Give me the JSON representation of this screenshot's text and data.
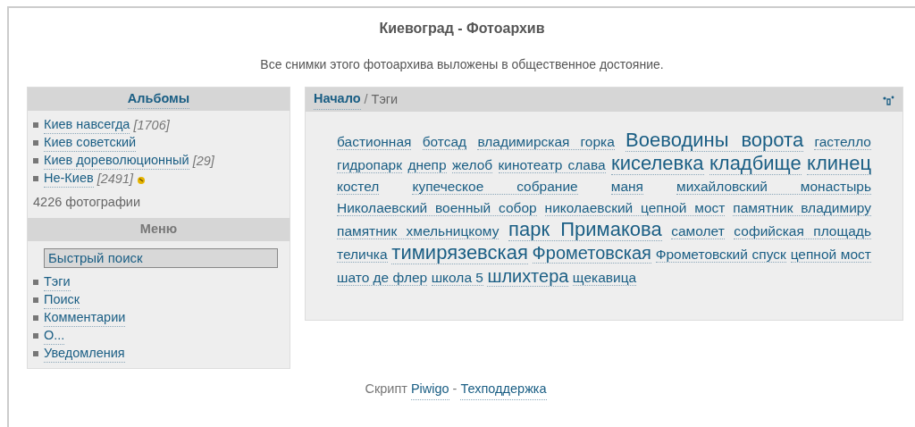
{
  "header": {
    "title": "Киевоград - Фотоархив",
    "subtitle": "Все снимки этого фотоархива выложены в общественное достояние."
  },
  "albums": {
    "title": "Альбомы",
    "items": [
      {
        "name": "Киев навсегда",
        "count": "[1706]",
        "recent": false
      },
      {
        "name": "Киев советский",
        "recent": false
      },
      {
        "name": "Киев дореволюционный",
        "count": "[29]",
        "recent": false
      },
      {
        "name": "Не-Киев",
        "count": "[2491]",
        "recent": true
      }
    ],
    "total": "4226 фотографии"
  },
  "menu": {
    "title": "Меню",
    "search": {
      "placeholder": "Быстрый поиск"
    },
    "items": [
      "Тэги",
      "Поиск",
      "Комментарии",
      "О...",
      "Уведомления"
    ]
  },
  "content": {
    "breadcrumb": {
      "home": "Начало",
      "separator": "/",
      "current": "Тэги"
    },
    "tags": [
      {
        "label": "бастионная",
        "kind": "normal"
      },
      {
        "label": "ботсад",
        "kind": "normal"
      },
      {
        "label": "владимирская горка",
        "kind": "normal"
      },
      {
        "label": "Воеводины ворота",
        "kind": "big"
      },
      {
        "label": "гастелло",
        "kind": "normal"
      },
      {
        "label": "гидропарк",
        "kind": "normal"
      },
      {
        "label": "днепр",
        "kind": "normal"
      },
      {
        "label": "желоб",
        "kind": "normal"
      },
      {
        "label": "кинотеатр слава",
        "kind": "normal"
      },
      {
        "label": "киселевка",
        "kind": "big"
      },
      {
        "label": "кладбище",
        "kind": "big"
      },
      {
        "label": "клинец",
        "kind": "big"
      },
      {
        "label": "костел",
        "kind": "normal"
      },
      {
        "label": "купеческое собрание",
        "kind": "normal"
      },
      {
        "label": "маня",
        "kind": "normal"
      },
      {
        "label": "михайловский монастырь",
        "kind": "normal"
      },
      {
        "label": "Николаевский военный собор",
        "kind": "normal"
      },
      {
        "label": "николаевский цепной мост",
        "kind": "normal"
      },
      {
        "label": "памятник владимиру",
        "kind": "normal"
      },
      {
        "label": "памятник хмельницкому",
        "kind": "normal"
      },
      {
        "label": "парк Примакова",
        "kind": "big"
      },
      {
        "label": "самолет",
        "kind": "normal"
      },
      {
        "label": "софийская площадь",
        "kind": "normal"
      },
      {
        "label": "теличка",
        "kind": "normal"
      },
      {
        "label": "тимирязевская",
        "kind": "big"
      },
      {
        "label": "Фрометовская",
        "kind": "medium"
      },
      {
        "label": "Фрометовский спуск",
        "kind": "normal"
      },
      {
        "label": "цепной мост",
        "kind": "normal"
      },
      {
        "label": "шато де флер",
        "kind": "normal"
      },
      {
        "label": "школа 5",
        "kind": "normal"
      },
      {
        "label": "шлихтера",
        "kind": "medium"
      },
      {
        "label": "щекавица",
        "kind": "normal"
      }
    ]
  },
  "footer": {
    "prefix": "Скрипт",
    "link": "Piwigo",
    "separator": "-",
    "support": "Техподдержка"
  }
}
